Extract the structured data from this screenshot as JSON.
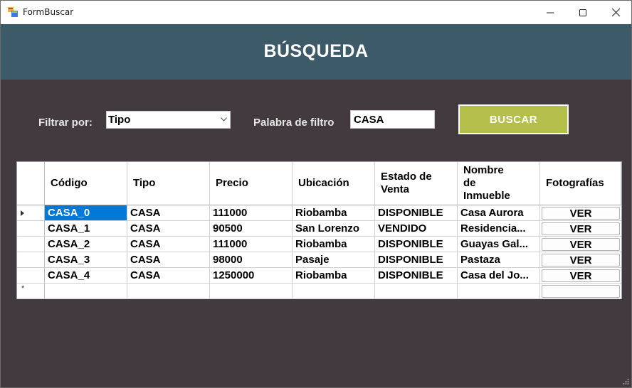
{
  "window": {
    "title": "FormBuscar"
  },
  "header": {
    "title": "BÚSQUEDA"
  },
  "filters": {
    "filter_label": "Filtrar por:",
    "filter_value": "Tipo",
    "word_label": "Palabra de filtro",
    "word_value": "CASA",
    "search_button": "BUSCAR"
  },
  "grid": {
    "columns": [
      "Código",
      "Tipo",
      "Precio",
      "Ubicación",
      "Estado de Venta",
      "Nombre de Inmueble",
      "Fotografías"
    ],
    "column_lines": {
      "estado": [
        "Estado de",
        "Venta"
      ],
      "nombre": [
        "Nombre",
        "de",
        "Inmueble"
      ]
    },
    "rows": [
      {
        "codigo": "CASA_0",
        "tipo": "CASA",
        "precio": "111000",
        "ubicacion": "Riobamba",
        "estado": "DISPONIBLE",
        "nombre": "Casa Aurora",
        "foto": "VER"
      },
      {
        "codigo": "CASA_1",
        "tipo": "CASA",
        "precio": "90500",
        "ubicacion": "San Lorenzo",
        "estado": "VENDIDO",
        "nombre": "Residencia...",
        "foto": "VER"
      },
      {
        "codigo": "CASA_2",
        "tipo": "CASA",
        "precio": "111000",
        "ubicacion": "Riobamba",
        "estado": "DISPONIBLE",
        "nombre": "Guayas Gal...",
        "foto": "VER"
      },
      {
        "codigo": "CASA_3",
        "tipo": "CASA",
        "precio": "98000",
        "ubicacion": "Pasaje",
        "estado": "DISPONIBLE",
        "nombre": "Pastaza",
        "foto": "VER"
      },
      {
        "codigo": "CASA_4",
        "tipo": "CASA",
        "precio": "1250000",
        "ubicacion": "Riobamba",
        "estado": "DISPONIBLE",
        "nombre": "Casa del Jo...",
        "foto": "VER"
      }
    ],
    "new_row_marker": "*"
  },
  "colors": {
    "header_bg": "#3d5a69",
    "body_bg": "#423a3e",
    "button_bg": "#b4c04b",
    "selection": "#0078d7"
  }
}
